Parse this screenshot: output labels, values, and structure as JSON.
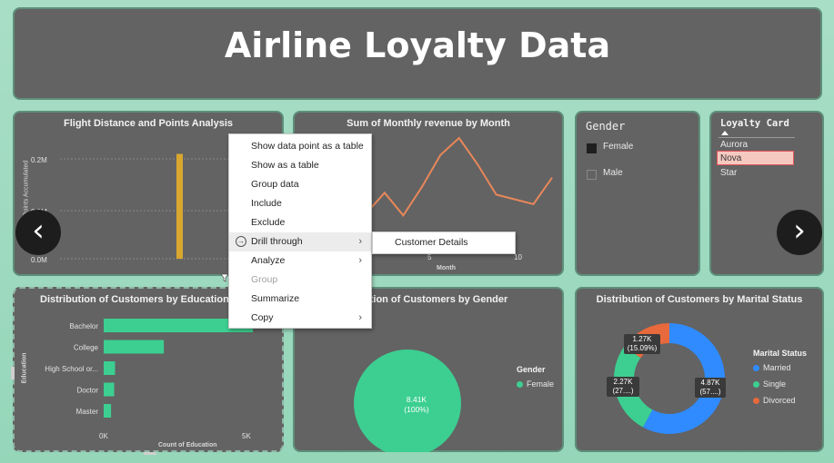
{
  "header": {
    "title": "Airline Loyalty Data"
  },
  "flight_chart": {
    "title": "Flight Distance and Points Analysis",
    "ylabel": "Sum of Points Accumulated",
    "y_ticks": [
      "0.2M",
      "0.1M",
      "0.0M"
    ]
  },
  "revenue_chart": {
    "title": "Sum of Monthly revenue by Month",
    "xlabel": "Month",
    "x_ticks": [
      "5",
      "10"
    ]
  },
  "gender_slicer": {
    "title": "Gender",
    "options": [
      {
        "label": "Female",
        "checked": true
      },
      {
        "label": "Male",
        "checked": false
      }
    ]
  },
  "loyalty_slicer": {
    "title": "Loyalty Card",
    "options": [
      {
        "label": "Aurora",
        "selected": false
      },
      {
        "label": "Nova",
        "selected": true
      },
      {
        "label": "Star",
        "selected": false
      }
    ]
  },
  "education_chart": {
    "title": "Distribution of Customers by Education",
    "ylabel": "Education",
    "xlabel": "Count of Education",
    "x_ticks": [
      "0K",
      "5K"
    ]
  },
  "gender_chart": {
    "title": "Distribution of Customers by Gender",
    "title_visible": "ution of Customers by Gender",
    "legend_title": "Gender",
    "legend_item": "Female",
    "value_label": "8.41K",
    "pct_label": "(100%)"
  },
  "marital_chart": {
    "title": "Distribution of Customers by Marital Status",
    "legend_title": "Marital Status",
    "legend": [
      {
        "label": "Married",
        "color": "#2f8bff"
      },
      {
        "label": "Single",
        "color": "#3ccf91"
      },
      {
        "label": "Divorced",
        "color": "#e8693b"
      }
    ],
    "labels": {
      "married_value": "4.87K",
      "married_pct": "(57....)",
      "single_value": "2.27K",
      "single_pct": "(27....)",
      "divorced_value": "1.27K",
      "divorced_pct": "(15.09%)"
    }
  },
  "context_menu": {
    "items": [
      {
        "label": "Show data point as a table",
        "disabled": false,
        "submenu": false
      },
      {
        "label": "Show as a table",
        "disabled": false,
        "submenu": false
      },
      {
        "label": "Group data",
        "disabled": false,
        "submenu": false
      },
      {
        "label": "Include",
        "disabled": false,
        "submenu": false
      },
      {
        "label": "Exclude",
        "disabled": false,
        "submenu": false
      },
      {
        "label": "Drill through",
        "disabled": false,
        "submenu": true
      },
      {
        "label": "Analyze",
        "disabled": false,
        "submenu": true
      },
      {
        "label": "Group",
        "disabled": true,
        "submenu": false
      },
      {
        "label": "Summarize",
        "disabled": false,
        "submenu": false
      },
      {
        "label": "Copy",
        "disabled": false,
        "submenu": true
      }
    ],
    "submenu_item": "Customer Details"
  },
  "nav": {
    "prev_glyph": "‹",
    "next_glyph": "›"
  },
  "chart_data": [
    {
      "type": "bar",
      "title": "Flight Distance and Points Analysis",
      "ylabel": "Sum of Points Accumulated",
      "ylim": [
        0,
        0.25
      ],
      "y_unit": "M",
      "bars": [
        {
          "value": 0.21
        }
      ]
    },
    {
      "type": "line",
      "title": "Sum of Monthly revenue by Month",
      "xlabel": "Month",
      "x": [
        1,
        2,
        3,
        4,
        5,
        6,
        7,
        8,
        9,
        10,
        11,
        12
      ],
      "series": [
        {
          "values": [
            28,
            20,
            42,
            18,
            48,
            82,
            100,
            72,
            40,
            35,
            30,
            58
          ]
        }
      ],
      "y_scale_note": "relative (no y-axis labels visible)"
    },
    {
      "type": "bar",
      "orientation": "horizontal",
      "title": "Distribution of Customers by Education",
      "categories": [
        "Bachelor",
        "College",
        "High School or...",
        "Doctor",
        "Master"
      ],
      "values": [
        5.26,
        2.12,
        0.4,
        0.37,
        0.26
      ],
      "xlabel": "Count of Education",
      "ylabel": "Education",
      "xlim": [
        0,
        5.5
      ],
      "unit": "K"
    },
    {
      "type": "pie",
      "title": "Distribution of Customers by Gender",
      "categories": [
        "Female"
      ],
      "values": [
        8.41
      ],
      "unit": "K",
      "colors": [
        "#3ccf91"
      ]
    },
    {
      "type": "pie",
      "donut": true,
      "title": "Distribution of Customers by Marital Status",
      "categories": [
        "Married",
        "Single",
        "Divorced"
      ],
      "values": [
        4.87,
        2.27,
        1.27
      ],
      "unit": "K",
      "colors": [
        "#2f8bff",
        "#3ccf91",
        "#e8693b"
      ]
    }
  ]
}
